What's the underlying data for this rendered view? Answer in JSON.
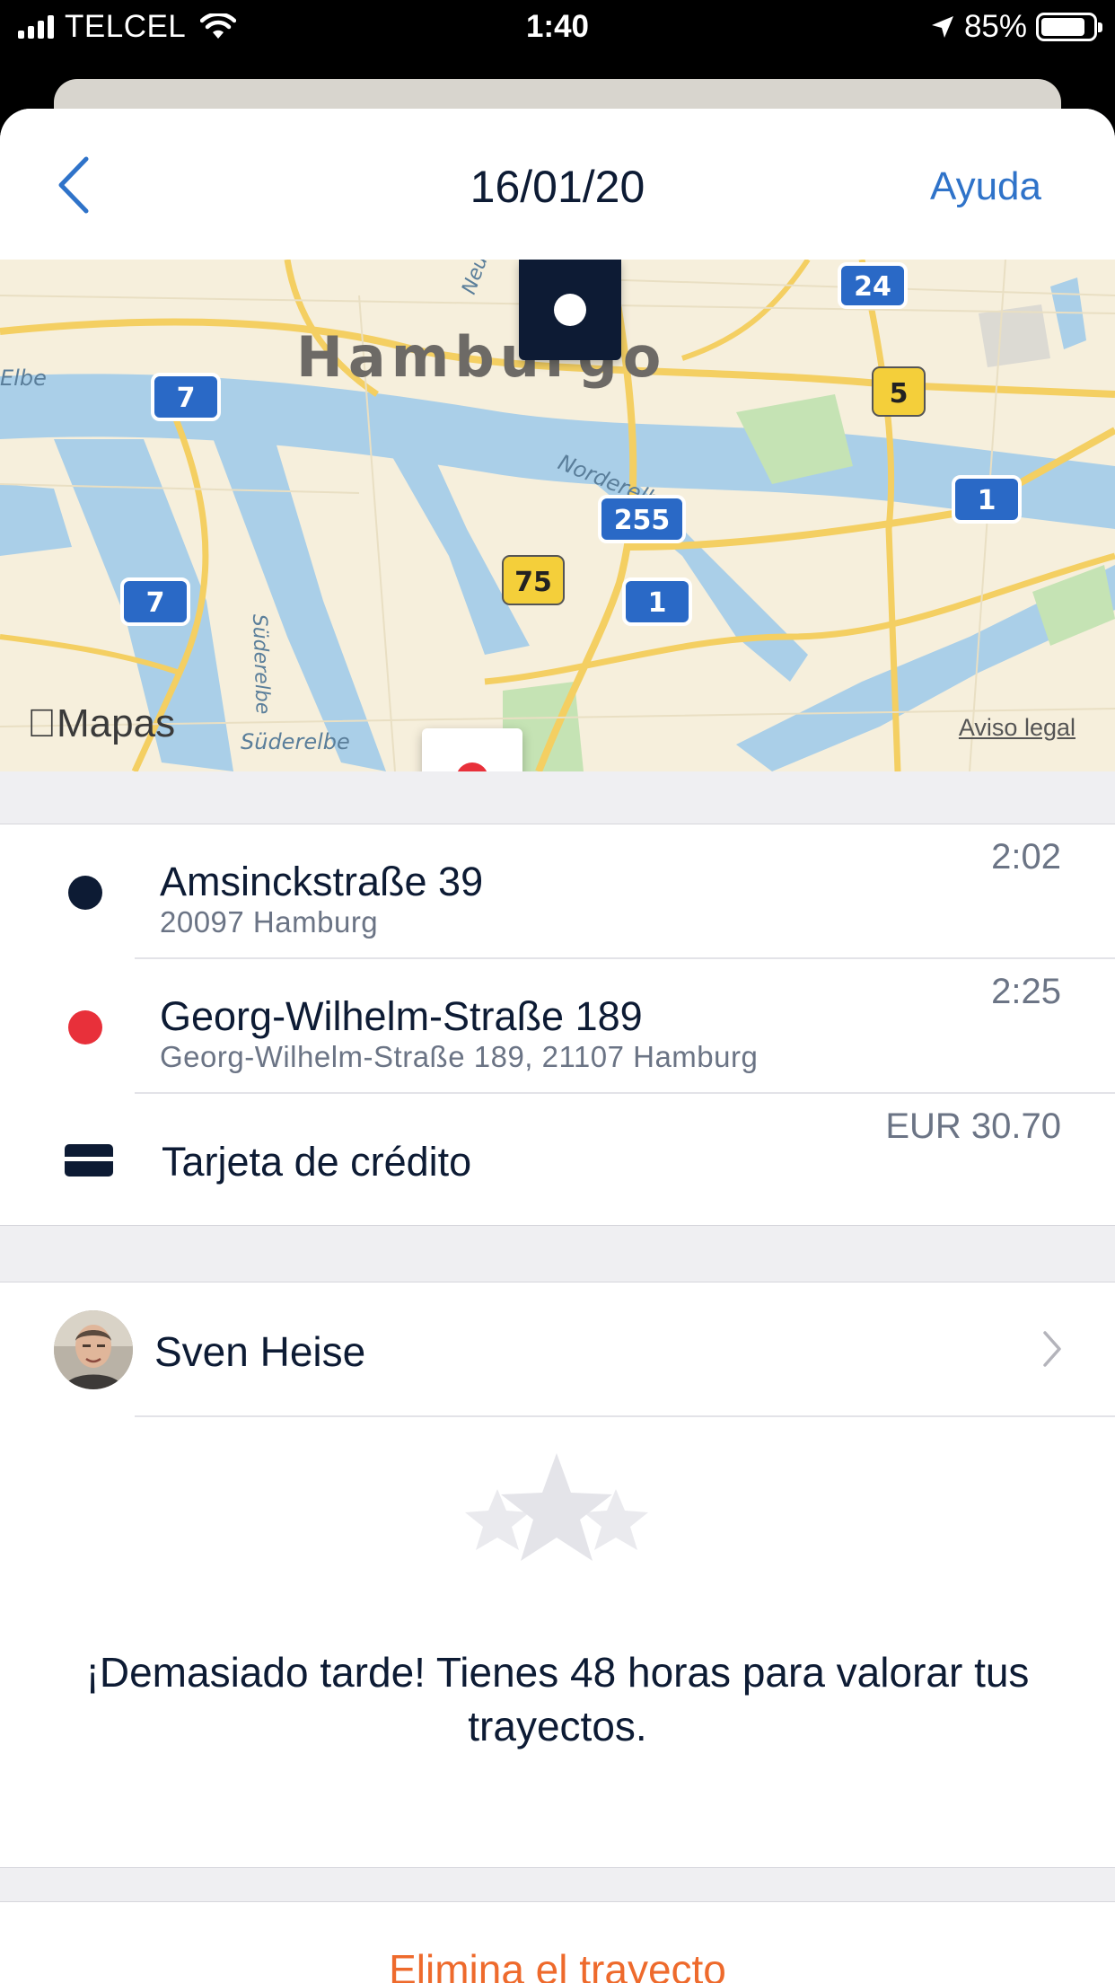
{
  "status_bar": {
    "carrier": "TELCEL",
    "time": "1:40",
    "battery": "85%",
    "battery_level": 0.85
  },
  "nav": {
    "title": "16/01/20",
    "help": "Ayuda"
  },
  "map": {
    "city_label": "Hamburgo",
    "maps_brand": "Mapas",
    "legal": "Aviso legal",
    "street_labels": [
      "Elbe",
      "Norderelbe",
      "Süderelbe",
      "Süderelbe",
      "Neu"
    ],
    "road_shields": [
      "24",
      "7",
      "5",
      "1",
      "255",
      "75",
      "1",
      "7"
    ]
  },
  "trip": {
    "start": {
      "street": "Amsinckstraße 39",
      "city": "20097 Hamburg",
      "time": "2:02",
      "color": "#0d1b34"
    },
    "end": {
      "street": "Georg-Wilhelm-Straße 189",
      "city": "Georg-Wilhelm-Straße 189, 21107 Hamburg",
      "time": "2:25",
      "color": "#e8303a"
    },
    "payment": {
      "method": "Tarjeta de crédito",
      "amount": "EUR 30.70"
    }
  },
  "driver": {
    "name": "Sven Heise"
  },
  "rating": {
    "message": "¡Demasiado tarde! Tienes 48 horas para valorar tus trayectos."
  },
  "actions": {
    "delete": "Elimina el trayecto"
  },
  "colors": {
    "accent": "#2f73c9",
    "danger": "#ee6a2c",
    "navy": "#0d1b34"
  }
}
